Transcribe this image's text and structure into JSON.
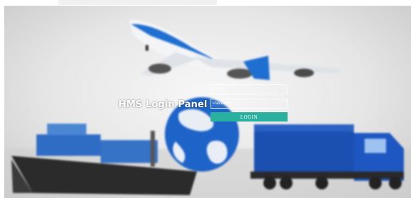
{
  "login_panel": {
    "title": "HMS Login Panel",
    "email_placeholder": "Email",
    "password_placeholder": "Password",
    "login_label": "LOGIN",
    "accent_color": "#2ab09f"
  },
  "background": {
    "description_icons": [
      "airplane",
      "globe",
      "container-ship",
      "cargo-truck"
    ],
    "palette": {
      "sky": "#e6e6e6",
      "blue": "#1d63c4",
      "dark": "#222222"
    }
  }
}
